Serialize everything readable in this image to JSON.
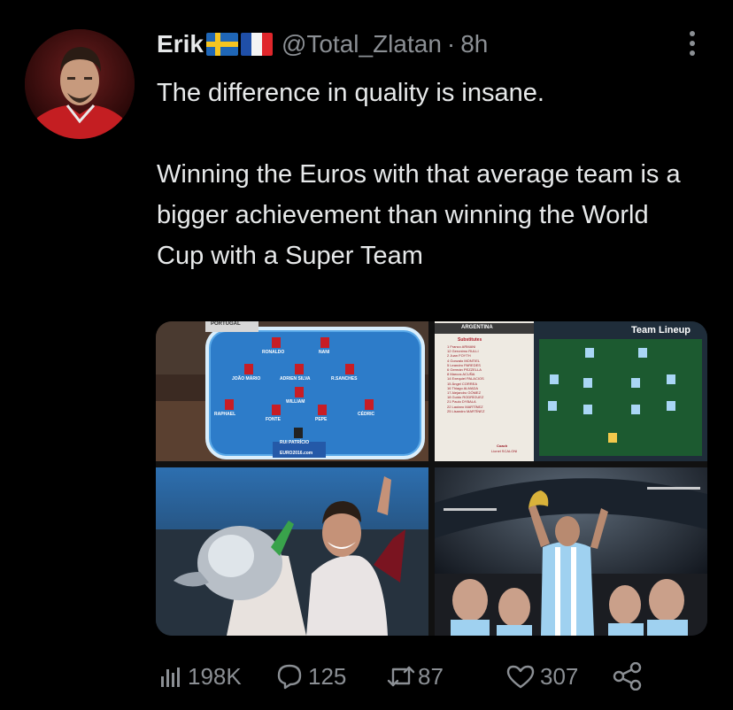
{
  "tweet": {
    "display_name": "Erik",
    "handle": "@Total_Zlatan",
    "separator": "·",
    "time": "8h",
    "text_line1": "The difference in quality is insane.",
    "text_para2": "Winning the Euros with that average team is a bigger achievement than winning the World Cup with a Super Team",
    "flags": [
      "sweden-flag",
      "france-flag"
    ]
  },
  "media": {
    "portugal_lineup": {
      "header": "PORTUGAL",
      "players": [
        "RONALDO",
        "NANI",
        "JOÃO MÁRIO",
        "ADRIEN SILVA",
        "R.SANCHES",
        "WILLIAM",
        "RAPHAEL",
        "FONTE",
        "PEPE",
        "CÉDRIC",
        "RUI PATRÍCIO"
      ],
      "footer": "EURO2016.com"
    },
    "argentina_lineup": {
      "header": "ARGENTINA",
      "subs_title": "Substitutes",
      "subs": [
        "1 Franco ARMANI",
        "12 Geronimo RULLI",
        "2 Juan FOYTH",
        "4 Gonzalo MONTIEL",
        "5 Leandro PAREDES",
        "6 Germán PEZZELLA",
        "8 Marcos ACUÑA",
        "14 Exequiel PALACIOS",
        "15 Ángel CORREA",
        "16 Thiago ALMADA",
        "17 Alejandro GÓMEZ",
        "18 Guido RODRÍGUEZ",
        "21 Paulo DYBALA",
        "22 Lautaro MARTÍNEZ",
        "25 Lisandro MARTÍNEZ"
      ],
      "coach_label": "Coach",
      "coach": "Lionel SCALONI",
      "board_title": "Team Lineup"
    }
  },
  "stats": {
    "views": "198K",
    "replies": "125",
    "retweets": "87",
    "likes": "307"
  },
  "colors": {
    "background": "#000000",
    "text": "#e7e9ea",
    "muted": "#8b8f94"
  }
}
